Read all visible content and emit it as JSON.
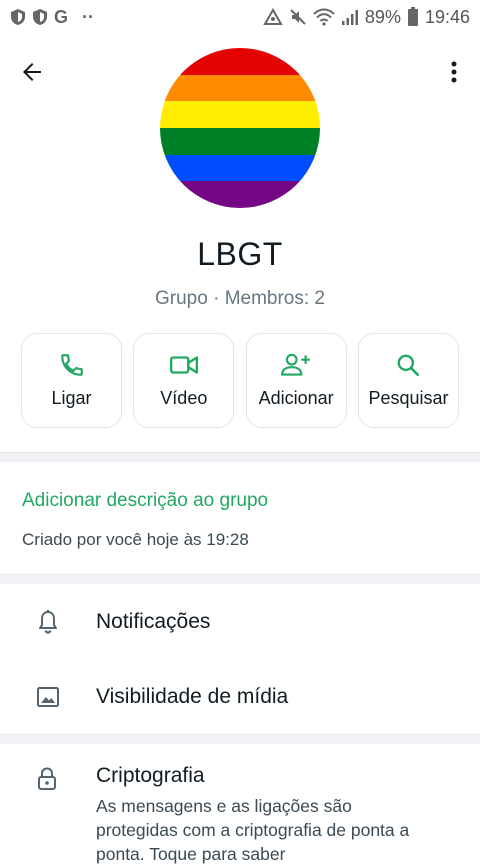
{
  "status_bar": {
    "left_icons": [
      "shield-icon",
      "shield-icon",
      "google-icon",
      "more-dots-icon"
    ],
    "g_letter": "G",
    "dots": "··",
    "battery": "89%",
    "time": "19:46"
  },
  "header": {
    "back_icon": "arrow-back-icon",
    "menu_icon": "more-vert-icon"
  },
  "avatar": {
    "colors": [
      "#e40303",
      "#ff8c00",
      "#ffed00",
      "#008026",
      "#004dff",
      "#750787"
    ]
  },
  "group": {
    "name": "LBGT",
    "subtitle": "Grupo · Membros: 2"
  },
  "actions": [
    {
      "label": "Ligar",
      "icon": "phone-icon"
    },
    {
      "label": "Vídeo",
      "icon": "video-icon"
    },
    {
      "label": "Adicionar",
      "icon": "add-person-icon"
    },
    {
      "label": "Pesquisar",
      "icon": "search-icon"
    }
  ],
  "description": {
    "add_link": "Adicionar descrição ao grupo",
    "created": "Criado por você hoje às 19:28"
  },
  "settings": {
    "notifications": "Notificações",
    "media_visibility": "Visibilidade de mídia"
  },
  "encryption": {
    "title": "Criptografia",
    "body": "As mensagens e as ligações são protegidas com a criptografia de ponta a ponta. Toque para saber"
  },
  "colors": {
    "accent": "#21a862",
    "text_primary": "#111b21",
    "text_secondary": "#667781"
  }
}
